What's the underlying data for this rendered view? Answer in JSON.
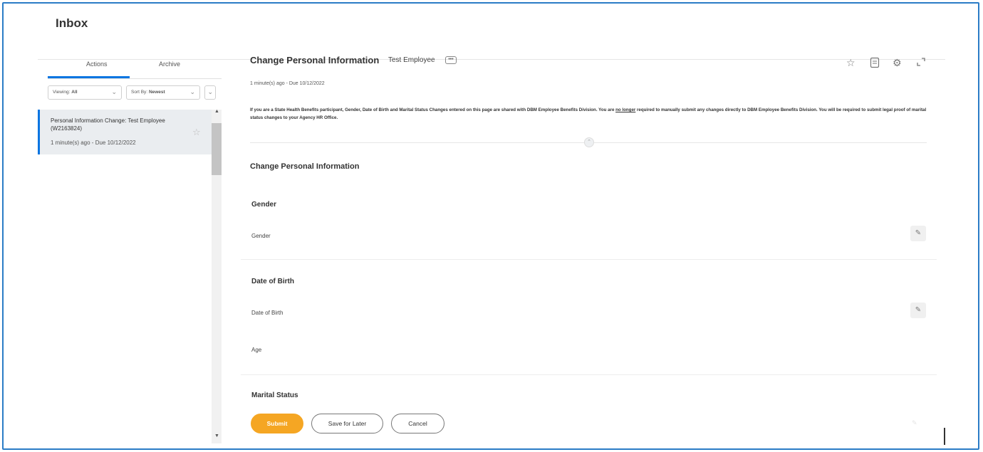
{
  "app": {
    "title": "Inbox"
  },
  "left": {
    "tabs": [
      {
        "label": "Actions"
      },
      {
        "label": "Archive"
      }
    ],
    "filters": {
      "viewing_label": "Viewing:",
      "viewing_value": "All",
      "sort_label": "Sort By:",
      "sort_value": "Newest"
    },
    "items": [
      {
        "title": "Personal Information Change: Test Employee (W2163824)",
        "subtitle": "1 minute(s) ago - Due 10/12/2022"
      }
    ]
  },
  "main": {
    "title": "Change Personal Information",
    "subject": "Test Employee",
    "more_label": "•••",
    "due": "1 minute(s) ago - Due 10/12/2022",
    "notice_part1": "If you are a State Health Benefits participant, Gender, Date of Birth and Marital Status Changes entered on this page are shared with DBM Employee Benefits Division.  You are ",
    "notice_emph": "no longer",
    "notice_part2": " required to manually submit any changes directly to DBM Employee Benefits Division.  You will be required to submit legal proof of marital status changes to your Agency HR Office.",
    "section_title": "Change Personal Information",
    "gender": {
      "heading": "Gender",
      "field": "Gender"
    },
    "dob": {
      "heading": "Date of Birth",
      "field": "Date of Birth",
      "age_field": "Age"
    },
    "marital": {
      "heading": "Marital Status"
    }
  },
  "footer": {
    "submit": "Submit",
    "save_for_later": "Save for Later",
    "cancel": "Cancel"
  },
  "icons": {
    "header": [
      "star-icon",
      "pdf-icon",
      "gear-icon",
      "expand-icon"
    ],
    "edit": "pencil-icon"
  },
  "colors": {
    "accent": "#0875e1",
    "submit": "#f5a623",
    "frame": "#2b7cc6"
  }
}
